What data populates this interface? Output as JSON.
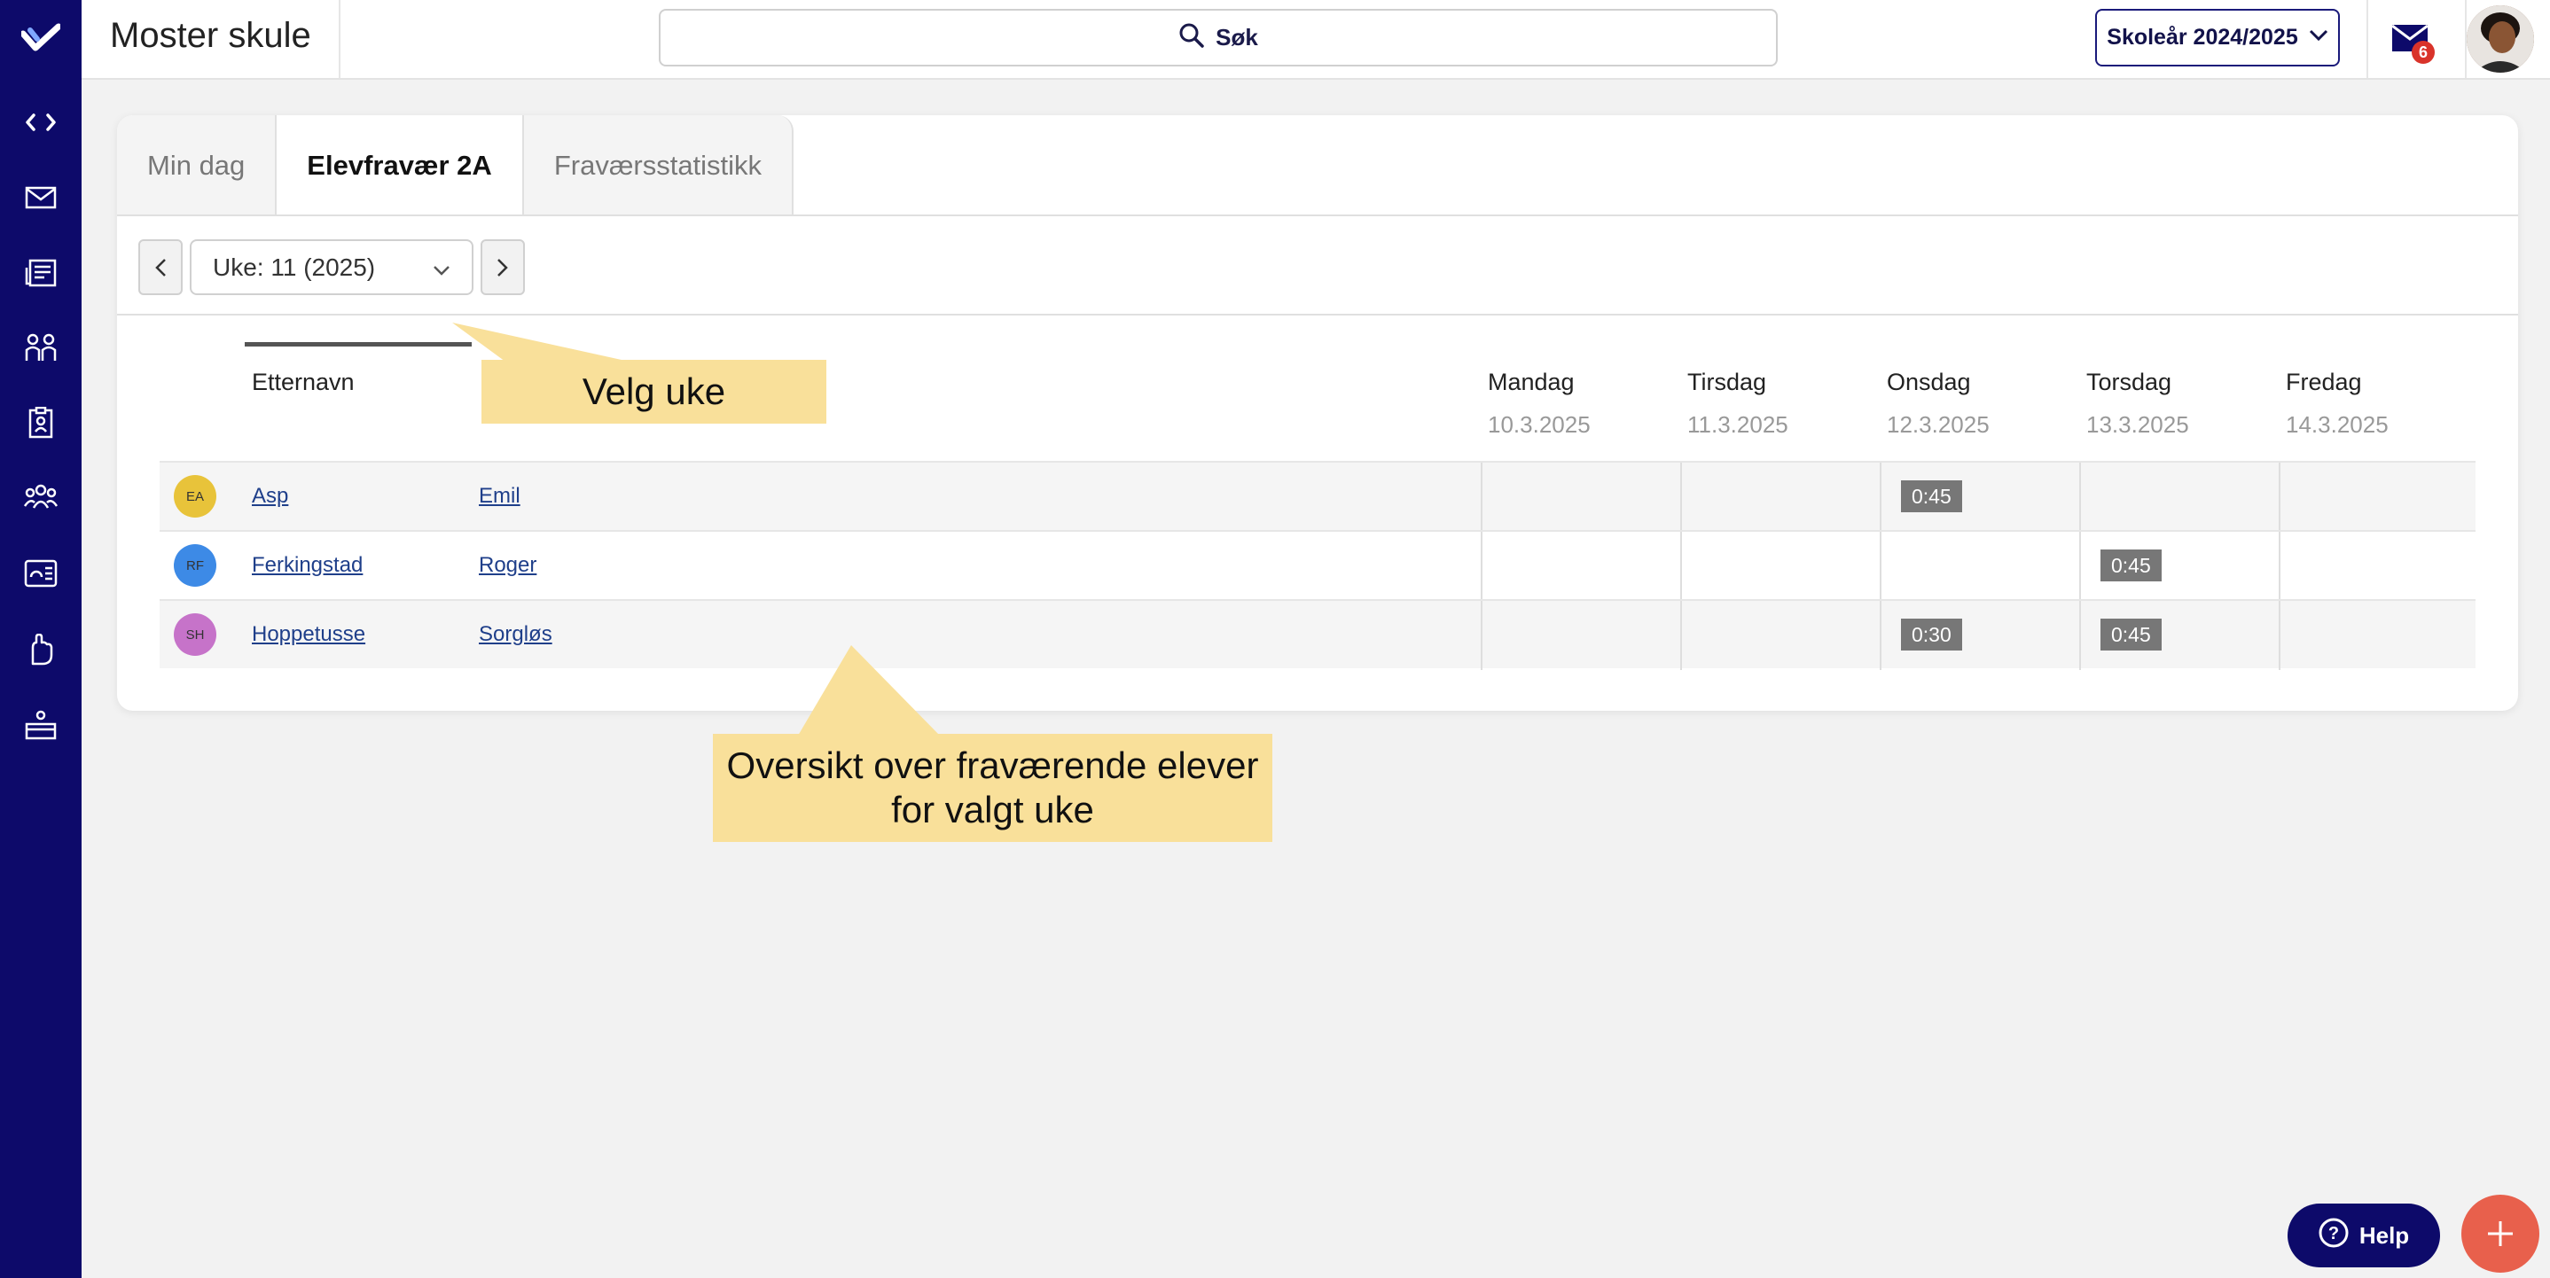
{
  "app": {
    "school_name": "Moster skule",
    "search_label": "Søk",
    "year_label": "Skoleår 2024/2025",
    "mail_badge": "6"
  },
  "sidebar": {
    "icons": [
      "logo-icon",
      "code-icon",
      "mail-icon",
      "news-icon",
      "groups-icon",
      "clipboard-icon",
      "people-icon",
      "dashboard-icon",
      "hand-icon",
      "workspace-icon"
    ]
  },
  "tabs": [
    {
      "label": "Min dag",
      "active": false
    },
    {
      "label": "Elevfravær 2A",
      "active": true
    },
    {
      "label": "Fraværsstatistikk",
      "active": false
    }
  ],
  "week": {
    "selected": "Uke: 11 (2025)"
  },
  "table": {
    "header_lastname": "Etternavn",
    "days": [
      {
        "name": "Mandag",
        "date": "10.3.2025"
      },
      {
        "name": "Tirsdag",
        "date": "11.3.2025"
      },
      {
        "name": "Onsdag",
        "date": "12.3.2025"
      },
      {
        "name": "Torsdag",
        "date": "13.3.2025"
      },
      {
        "name": "Fredag",
        "date": "14.3.2025"
      }
    ],
    "rows": [
      {
        "initials": "EA",
        "color": "#e8c33a",
        "last": "Asp",
        "first": "Emil",
        "absence": [
          "",
          "",
          "0:45",
          "",
          ""
        ]
      },
      {
        "initials": "RF",
        "color": "#3d8ae6",
        "last": "Ferkingstad",
        "first": "Roger",
        "absence": [
          "",
          "",
          "",
          "0:45",
          ""
        ]
      },
      {
        "initials": "SH",
        "color": "#c673c9",
        "last": "Hoppetusse",
        "first": "Sorgløs",
        "absence": [
          "",
          "",
          "0:30",
          "0:45",
          ""
        ]
      }
    ]
  },
  "callouts": {
    "week": "Velg uke",
    "overview_line1": "Oversikt over fraværende elever",
    "overview_line2": "for valgt uke"
  },
  "help": {
    "label": "Help"
  },
  "colors": {
    "sidebar": "#0d0a6a",
    "callout": "#f9e09a",
    "plus": "#e8604c"
  }
}
